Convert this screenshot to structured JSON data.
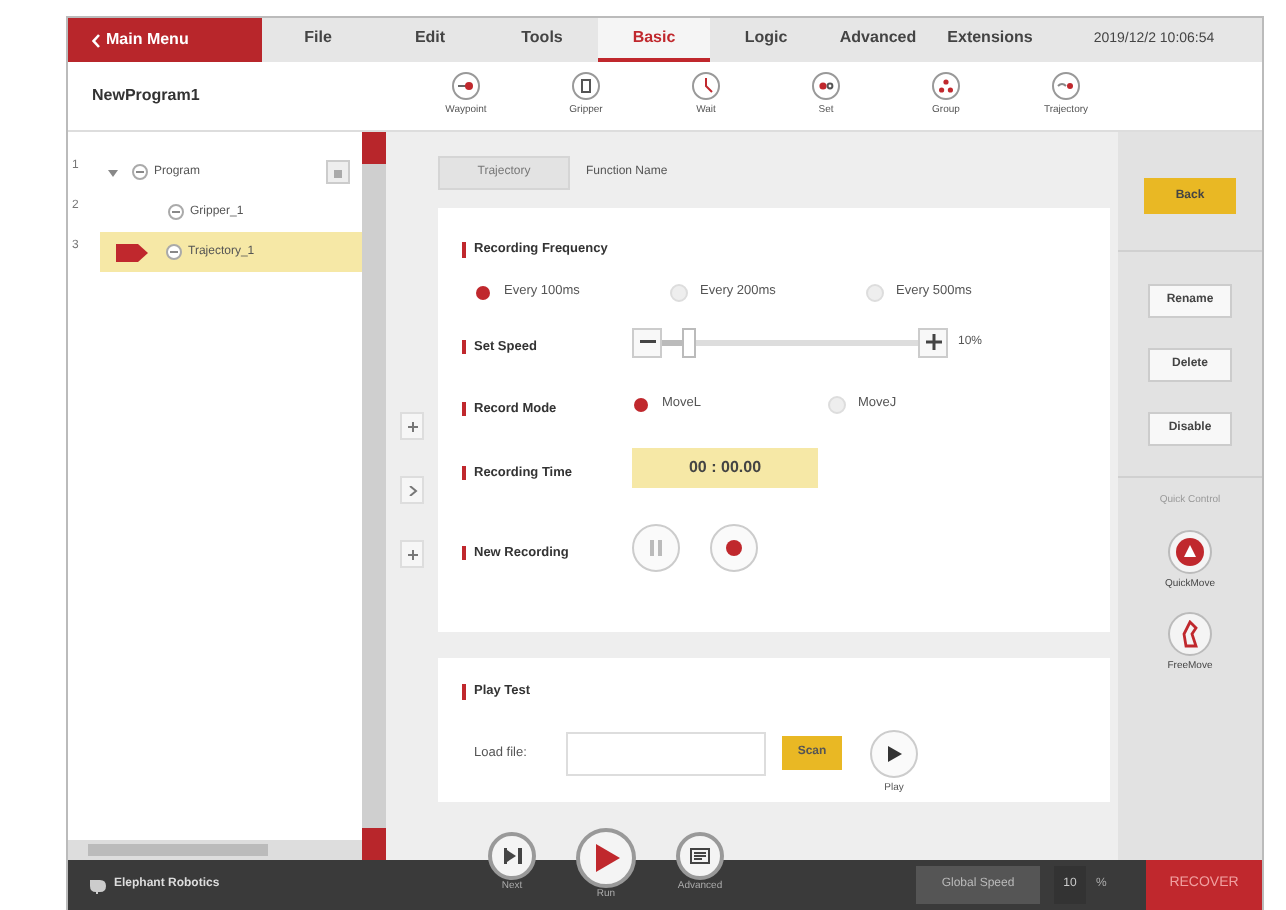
{
  "menu": {
    "main_menu": "Main Menu",
    "tabs": [
      {
        "label": "File",
        "selected": false
      },
      {
        "label": "Edit",
        "selected": false
      },
      {
        "label": "Tools",
        "selected": false
      },
      {
        "label": "Basic",
        "selected": true
      },
      {
        "label": "Logic",
        "selected": false
      },
      {
        "label": "Advanced",
        "selected": false
      },
      {
        "label": "Extensions",
        "selected": false
      }
    ],
    "datetime": "2019/12/2 10:06:54"
  },
  "program_name": "NewProgram1",
  "toolbar": [
    {
      "label": "Waypoint",
      "kind": "waypoint"
    },
    {
      "label": "Gripper",
      "kind": "gripper"
    },
    {
      "label": "Wait",
      "kind": "wait"
    },
    {
      "label": "Set",
      "kind": "set"
    },
    {
      "label": "Group",
      "kind": "group"
    },
    {
      "label": "Trajectory",
      "kind": "trajectory"
    }
  ],
  "tree": {
    "line_numbers": [
      "1",
      "2",
      "3"
    ],
    "items": [
      {
        "label": "Program",
        "expanded": true,
        "selected": false,
        "children": [
          {
            "label": "Gripper_1",
            "selected": false
          },
          {
            "label": "Trajectory_1",
            "selected": true
          }
        ]
      }
    ]
  },
  "editor": {
    "tab": "Trajectory",
    "function_name": "Function Name",
    "recording_frequency": {
      "label": "Recording Frequency",
      "options": [
        {
          "label": "Every 100ms",
          "selected": true
        },
        {
          "label": "Every 200ms",
          "selected": false
        },
        {
          "label": "Every 500ms",
          "selected": false
        }
      ]
    },
    "set_speed": {
      "label": "Set Speed",
      "level": 0.1,
      "reading": "10%"
    },
    "record_mode": {
      "label": "Record Mode",
      "options": [
        {
          "label": "MoveL",
          "selected": true
        },
        {
          "label": "MoveJ",
          "selected": false
        }
      ]
    },
    "recording_time": {
      "label": "Recording Time",
      "value": "00 : 00.00"
    },
    "new_recording": {
      "label": "New Recording"
    },
    "play_test": {
      "label": "Play Test",
      "load_file_label": "Load file:",
      "scan": "Scan",
      "play": "Play"
    }
  },
  "actions": {
    "back": "Back",
    "buttons": [
      "Rename",
      "Delete",
      "Disable"
    ],
    "quick_control": "Quick Control",
    "quick": [
      {
        "label": "QuickMove",
        "kind": "quickmove"
      },
      {
        "label": "FreeMove",
        "kind": "freemove"
      }
    ]
  },
  "bottom": {
    "brand": "Elephant Robotics",
    "controls": [
      {
        "label": "Next",
        "kind": "next"
      },
      {
        "label": "Run",
        "kind": "run"
      },
      {
        "label": "Advanced",
        "kind": "advanced"
      }
    ],
    "global_speed": "Global Speed",
    "speed_value": "10",
    "percent": "%",
    "recover": "RECOVER"
  }
}
